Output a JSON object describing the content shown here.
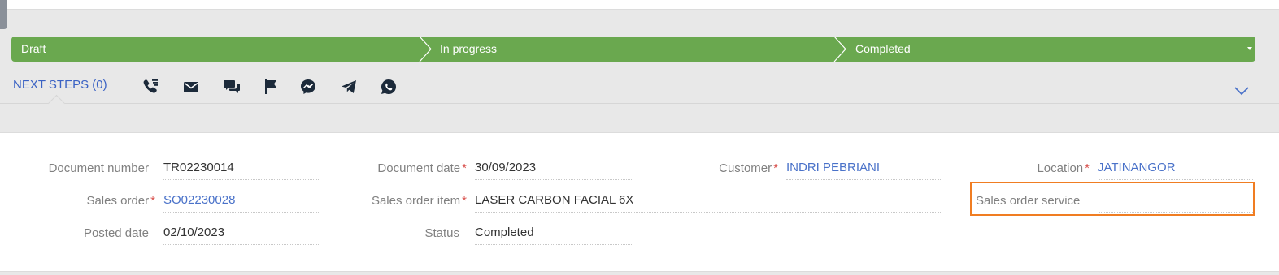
{
  "stages": [
    "Draft",
    "In progress",
    "Completed"
  ],
  "next_steps": {
    "label": "NEXT STEPS (0)"
  },
  "actions": [
    "call-icon",
    "email-icon",
    "chat-icon",
    "flag-icon",
    "messenger-icon",
    "telegram-icon",
    "whatsapp-icon"
  ],
  "colors": {
    "stage_bar": "#6aa84f",
    "link": "#4a72c9",
    "required": "#d9534f",
    "highlight": "#f07d22"
  },
  "fields": {
    "document_number": {
      "label": "Document number",
      "value": "TR02230014"
    },
    "sales_order": {
      "label": "Sales order",
      "value": "SO02230028"
    },
    "posted_date": {
      "label": "Posted date",
      "value": "02/10/2023"
    },
    "document_date": {
      "label": "Document date",
      "value": "30/09/2023"
    },
    "sales_order_item": {
      "label": "Sales order item",
      "value": "LASER CARBON FACIAL 6X"
    },
    "status": {
      "label": "Status",
      "value": "Completed"
    },
    "customer": {
      "label": "Customer",
      "value": "INDRI PEBRIANI"
    },
    "location": {
      "label": "Location",
      "value": "JATINANGOR"
    },
    "sales_order_service": {
      "label": "Sales order service",
      "value": ""
    }
  },
  "required_mark": "*"
}
